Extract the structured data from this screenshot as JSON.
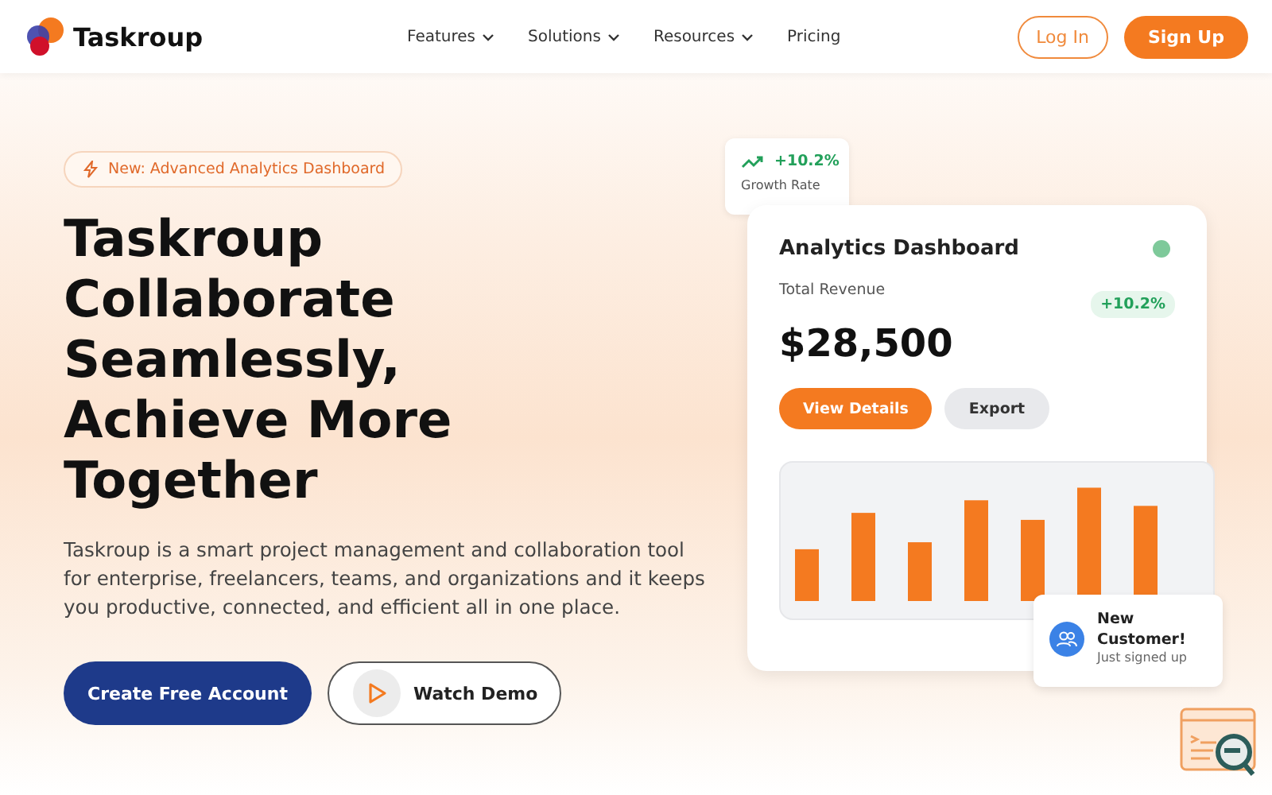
{
  "nav": {
    "brand": "Taskroup",
    "links": [
      {
        "label": "Features",
        "dropdown": true
      },
      {
        "label": "Solutions",
        "dropdown": true
      },
      {
        "label": "Resources",
        "dropdown": true
      },
      {
        "label": "Pricing",
        "dropdown": false
      }
    ],
    "login": "Log In",
    "signup": "Sign Up"
  },
  "hero": {
    "badge": "New: Advanced Analytics Dashboard",
    "title_lines": [
      "Taskroup",
      "Collaborate",
      "Seamlessly,",
      "Achieve More",
      "Together"
    ],
    "description": "Taskroup is a smart project management and collaboration tool for enterprise, freelancers, teams, and organizations and it keeps you productive, connected, and efficient all in one place.",
    "primary_button": "Create Free Account",
    "secondary_button": "Watch Demo"
  },
  "growth_badge": {
    "value": "+10.2%",
    "label": "Growth Rate"
  },
  "dashboard": {
    "title": "Analytics Dashboard",
    "metric_label": "Total Revenue",
    "change": "+10.2%",
    "amount": "$28,500",
    "buttons": [
      {
        "label": "View Details",
        "kind": "primary"
      },
      {
        "label": "Export",
        "kind": "secondary"
      }
    ]
  },
  "notification": {
    "title": "New Customer!",
    "subtitle": "Just signed up"
  }
}
